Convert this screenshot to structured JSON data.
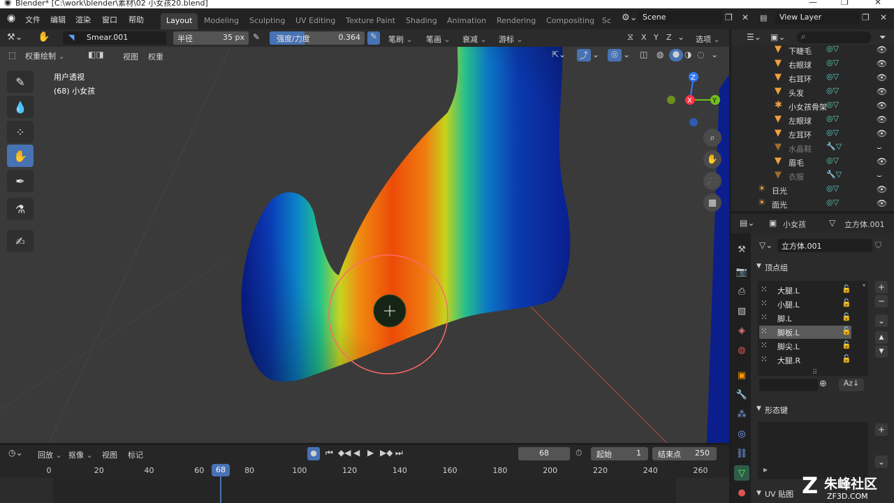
{
  "window": {
    "title": "Blender* [C:\\work\\blender\\素材\\02 小女孩20.blend]"
  },
  "menu": {
    "items": [
      "文件",
      "编辑",
      "渲染",
      "窗口",
      "帮助"
    ]
  },
  "workspaces": {
    "tabs": [
      "Layout",
      "Modeling",
      "Sculpting",
      "UV Editing",
      "Texture Paint",
      "Shading",
      "Animation",
      "Rendering",
      "Compositing",
      "Sc"
    ],
    "active": "Layout"
  },
  "scene": {
    "name": "Scene",
    "view_layer": "View Layer"
  },
  "tool_header": {
    "brush_name": "Smear.001",
    "radius_label": "半径",
    "radius_value": "35 px",
    "strength_label": "强度/力度",
    "strength_value": "0.364",
    "strength_fraction": 0.364,
    "brush_dd": "笔刷",
    "stroke_dd": "笔画",
    "falloff_dd": "衰减",
    "cursor_dd": "游标",
    "options_dd": "选项",
    "axes": [
      "X",
      "Y",
      "Z"
    ]
  },
  "view_header": {
    "mode": "权重绘制",
    "view_menu": "视图",
    "weights_menu": "权重"
  },
  "viewport": {
    "perspective": "用户透视",
    "object_info": "(68) 小女孩",
    "gizmo": {
      "x": "X",
      "y": "Y",
      "z": "Z"
    }
  },
  "outliner": {
    "rows": [
      {
        "label": "下睫毛",
        "dim": false
      },
      {
        "label": "右眼球",
        "dim": false
      },
      {
        "label": "右耳环",
        "dim": false
      },
      {
        "label": "头发",
        "dim": false
      },
      {
        "label": "小女孩骨架",
        "dim": false
      },
      {
        "label": "左眼球",
        "dim": false
      },
      {
        "label": "左耳环",
        "dim": false
      },
      {
        "label": "水晶鞋",
        "dim": true
      },
      {
        "label": "眉毛",
        "dim": false
      },
      {
        "label": "衣服",
        "dim": true
      },
      {
        "label": "日光",
        "dim": false
      },
      {
        "label": "面光",
        "dim": false
      }
    ]
  },
  "properties": {
    "object_name": "小女孩",
    "mesh_name_header": "立方体.001",
    "mesh_name_field": "立方体.001",
    "vertex_groups_title": "顶点组",
    "vertex_groups": [
      "大腿.L",
      "小腿.L",
      "脚.L",
      "脚板.L",
      "脚尖.L",
      "大腿.R"
    ],
    "selected_group": "脚板.L",
    "shape_keys_title": "形态键",
    "uv_maps_title": "UV 贴图"
  },
  "timeline": {
    "playback_dd": "回放",
    "keying_dd": "抠像",
    "view_menu": "视图",
    "marker_menu": "标记",
    "current_frame": "68",
    "start_label": "起始",
    "start_value": "1",
    "end_label": "结束点",
    "end_value": "250",
    "ticks": [
      "0",
      "20",
      "40",
      "60",
      "68",
      "80",
      "100",
      "120",
      "140",
      "160",
      "180",
      "200",
      "220",
      "240",
      "260"
    ]
  },
  "watermark": {
    "line1": "朱峰社区",
    "line2": "ZF3D.COM"
  }
}
